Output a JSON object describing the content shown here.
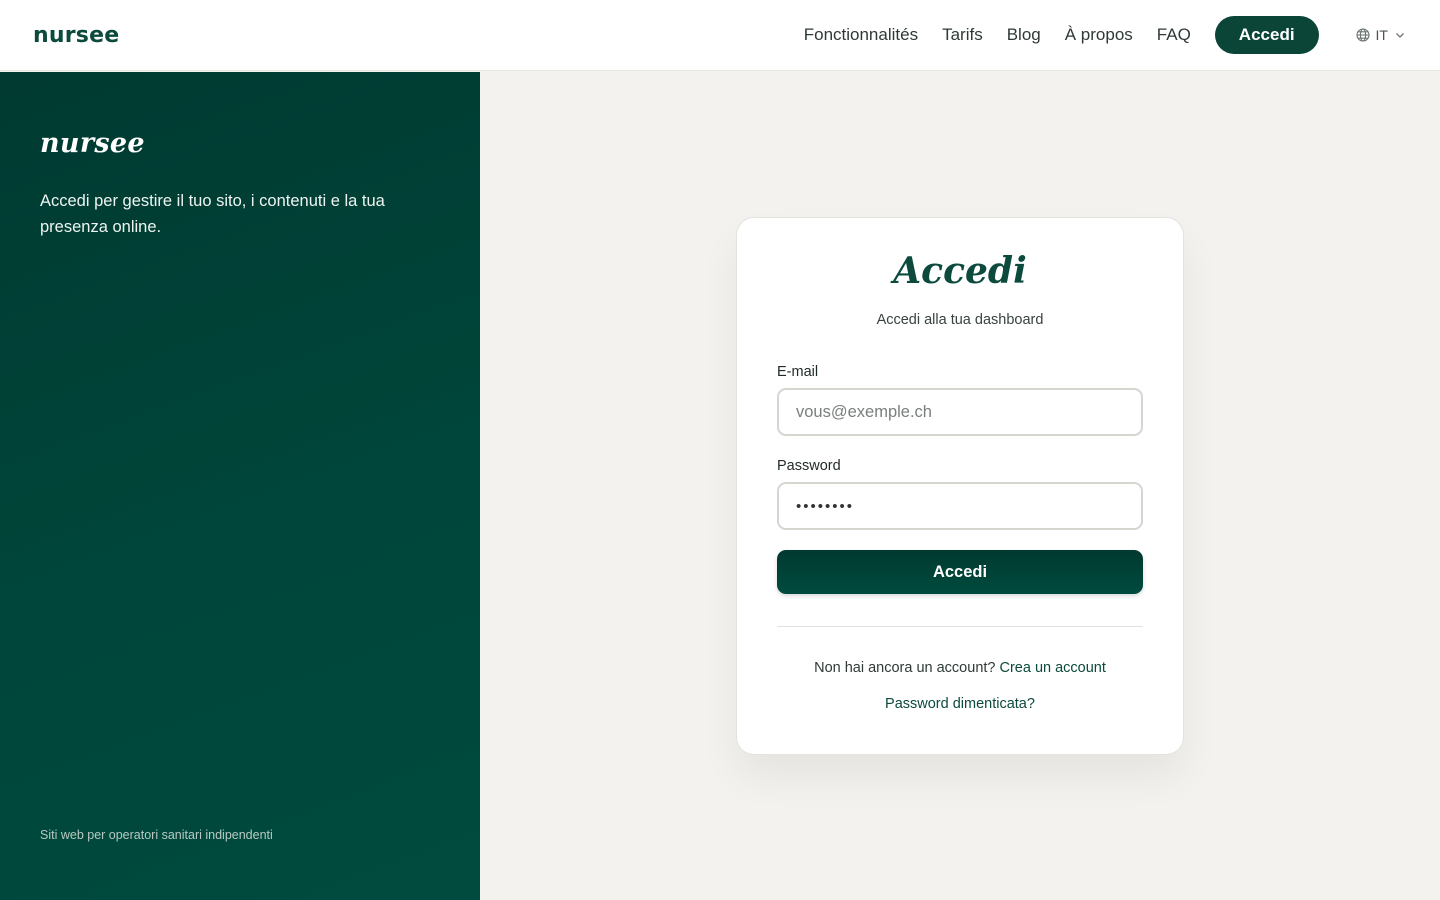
{
  "nav": {
    "brand": "nursee",
    "links": [
      "Fonctionnalités",
      "Tarifs",
      "Blog",
      "À propos",
      "FAQ"
    ],
    "cta": "Accedi",
    "language": "IT"
  },
  "side": {
    "logo": "nursee",
    "intro": "Accedi per gestire il tuo sito, i contenuti e la tua presenza online.",
    "footer": "Siti web per operatori sanitari indipendenti"
  },
  "login": {
    "title": "Accedi",
    "subtitle": "Accedi alla tua dashboard",
    "email_label": "E-mail",
    "email_placeholder": "vous@exemple.ch",
    "password_label": "Password",
    "password_value": "••••••••",
    "submit_label": "Accedi",
    "signup_prompt": "Non hai ancora un account?",
    "signup_link": "Crea un account",
    "forgot_link": "Password dimenticata?"
  },
  "colors": {
    "brand": "#0b4a3c",
    "panel": "#003f34",
    "background": "#f3f2ee"
  }
}
